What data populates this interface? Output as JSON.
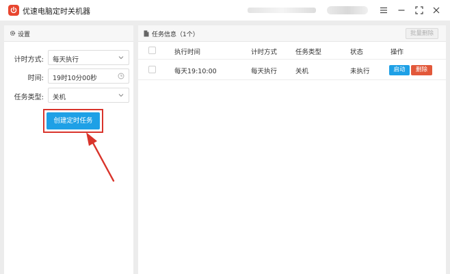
{
  "window": {
    "title": "优速电脑定时关机器",
    "accent": "#e8462f"
  },
  "settings_panel": {
    "header": "设置",
    "fields": [
      {
        "label": "计时方式:",
        "value": "每天执行",
        "kind": "select"
      },
      {
        "label": "时间:",
        "value": "19时10分00秒",
        "kind": "time"
      },
      {
        "label": "任务类型:",
        "value": "关机",
        "kind": "select"
      }
    ],
    "create_button": "创建定时任务"
  },
  "task_panel": {
    "header": "任务信息（1个）",
    "bulk_delete": "批量删除",
    "columns": [
      "执行时间",
      "计时方式",
      "任务类型",
      "状态",
      "操作"
    ],
    "rows": [
      {
        "time": "每天19:10:00",
        "mode": "每天执行",
        "type": "关机",
        "status": "未执行",
        "start_label": "启动",
        "delete_label": "删除"
      }
    ]
  },
  "colors": {
    "primary": "#1ea0e6",
    "danger": "#e2583a",
    "highlight": "#d9342b"
  }
}
